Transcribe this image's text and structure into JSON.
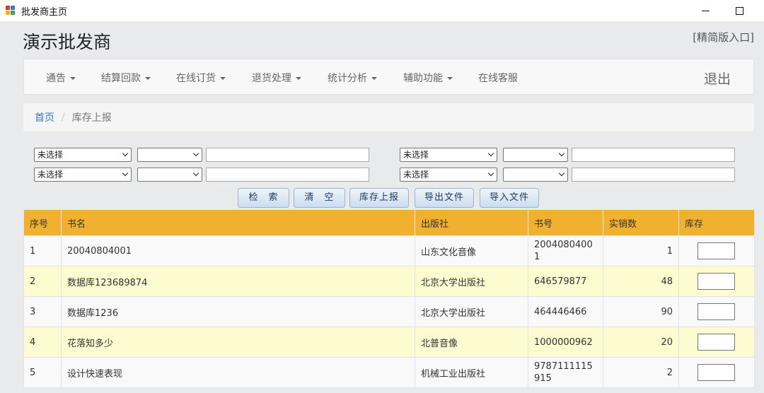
{
  "window": {
    "title": "批发商主页"
  },
  "header": {
    "brand": "演示批发商",
    "lite_link": "[精简版入口]"
  },
  "navbar": {
    "items": [
      {
        "label": "通告",
        "dropdown": true
      },
      {
        "label": "结算回款",
        "dropdown": true
      },
      {
        "label": "在线订货",
        "dropdown": true
      },
      {
        "label": "退货处理",
        "dropdown": true
      },
      {
        "label": "统计分析",
        "dropdown": true
      },
      {
        "label": "辅助功能",
        "dropdown": true
      },
      {
        "label": "在线客服",
        "dropdown": false
      }
    ],
    "logout": "退出"
  },
  "breadcrumb": {
    "home": "首页",
    "separator": "/",
    "current": "库存上报"
  },
  "filters": {
    "rows": [
      {
        "left_field": "未选择",
        "left_op": "",
        "left_value": "",
        "right_field": "未选择",
        "right_op": "",
        "right_value": ""
      },
      {
        "left_field": "未选择",
        "left_op": "",
        "left_value": "",
        "right_field": "未选择",
        "right_op": "",
        "right_value": ""
      }
    ]
  },
  "actions": {
    "search": "检　索",
    "clear": "清　空",
    "report": "库存上报",
    "export": "导出文件",
    "import": "导入文件"
  },
  "table": {
    "columns": [
      "序号",
      "书名",
      "出版社",
      "书号",
      "实销数",
      "库存"
    ],
    "rows": [
      {
        "no": "1",
        "title": "20040804001",
        "publisher": "山东文化音像",
        "isbn": "20040804001",
        "sold": "1",
        "stock": ""
      },
      {
        "no": "2",
        "title": "数据库123689874",
        "publisher": "北京大学出版社",
        "isbn": "646579877",
        "sold": "48",
        "stock": ""
      },
      {
        "no": "3",
        "title": "数据库1236",
        "publisher": "北京大学出版社",
        "isbn": "464446466",
        "sold": "90",
        "stock": ""
      },
      {
        "no": "4",
        "title": "花落知多少",
        "publisher": "北普音像",
        "isbn": "1000000962",
        "sold": "20",
        "stock": ""
      },
      {
        "no": "5",
        "title": "设计快速表现",
        "publisher": "机械工业出版社",
        "isbn": "9787111115915",
        "sold": "2",
        "stock": ""
      }
    ]
  },
  "colors": {
    "header_bg": "#f2b030",
    "even_row_bg": "#fdfbd0",
    "link": "#337ab7"
  },
  "icons": {
    "app": "app-logo-icon",
    "minimize": "minimize-icon",
    "maximize": "maximize-icon",
    "dropdown": "caret-down-icon"
  }
}
